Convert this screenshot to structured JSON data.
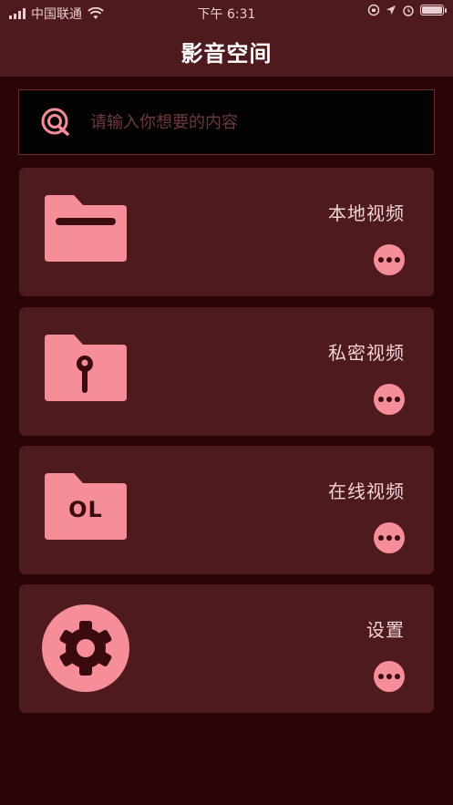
{
  "status_bar": {
    "carrier": "中国联通",
    "time": "下午 6:31"
  },
  "header": {
    "title": "影音空间"
  },
  "search": {
    "placeholder": "请输入你想要的内容"
  },
  "menu": [
    {
      "label": "本地视频",
      "icon": "folder-icon"
    },
    {
      "label": "私密视频",
      "icon": "locked-folder-icon"
    },
    {
      "label": "在线视频",
      "icon": "online-folder-icon",
      "badge": "OL"
    },
    {
      "label": "设置",
      "icon": "gear-icon"
    }
  ],
  "colors": {
    "background": "#2a0508",
    "card": "#4e1a1e",
    "accent": "#f58e98",
    "text": "#f2d4d6"
  }
}
